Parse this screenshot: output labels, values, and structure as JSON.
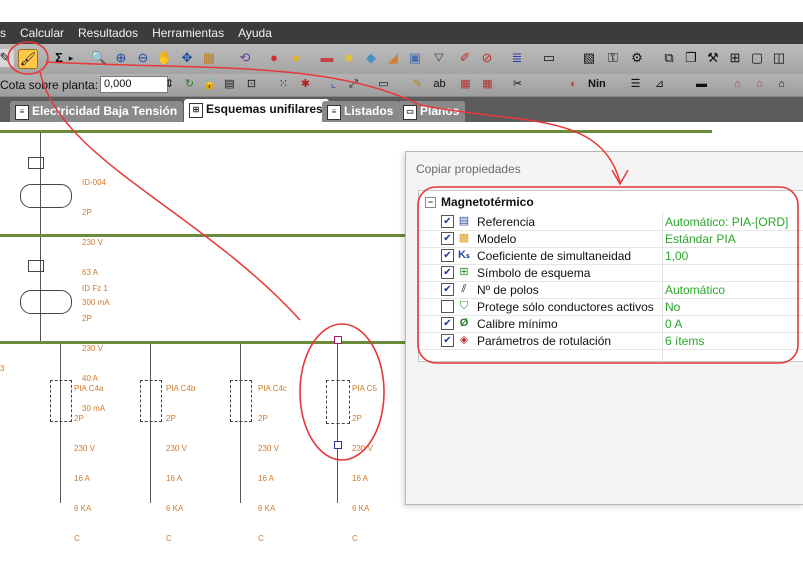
{
  "menu": [
    "s",
    "Calcular",
    "Resultados",
    "Herramientas",
    "Ayuda"
  ],
  "toolbar2": {
    "cota_label": "Cota sobre planta:",
    "cota_value": "0,000",
    "language_label": "Nin"
  },
  "tabs": [
    {
      "label": "Electricidad Baja Tensión",
      "active": false
    },
    {
      "label": "Esquemas unifilares",
      "active": true
    },
    {
      "label": "Listados",
      "active": false
    },
    {
      "label": "Planos",
      "active": false
    }
  ],
  "schematic": {
    "elements": [
      {
        "id": "diff-top",
        "lines": [
          "ID-004",
          "2P",
          "230 V",
          "63 A",
          "300 mA"
        ]
      },
      {
        "id": "diff-2",
        "lines": [
          "ID Fz 1",
          "2P",
          "230 V",
          "40 A",
          "30 mA"
        ]
      },
      {
        "id": "pia-c4a",
        "lines": [
          "PIA C4a",
          "2P",
          "230 V",
          "16 A",
          "6 KA",
          "C"
        ]
      },
      {
        "id": "pia-c4b",
        "lines": [
          "PIA C4b",
          "2P",
          "230 V",
          "16 A",
          "6 KA",
          "C"
        ]
      },
      {
        "id": "pia-c4c",
        "lines": [
          "PIA C4c",
          "2P",
          "230 V",
          "16 A",
          "6 KA",
          "C"
        ]
      },
      {
        "id": "pia-c5",
        "lines": [
          "PIA C5",
          "2P",
          "230 V",
          "16 A",
          "6 KA",
          "C"
        ]
      }
    ],
    "partial_label": "3"
  },
  "dialog": {
    "title": "Copiar propiedades",
    "group": "Magnetotérmico",
    "properties": [
      {
        "name": "Referencia",
        "value": "Automático: PIA-[ORD]",
        "checked": true,
        "icon": "reference-icon"
      },
      {
        "name": "Modelo",
        "value": "Estándar PIA",
        "checked": true,
        "icon": "model-box-icon"
      },
      {
        "name": "Coeficiente de simultaneidad",
        "value": "1,00",
        "checked": true,
        "icon": "ks-coefficient-icon"
      },
      {
        "name": "Símbolo de esquema",
        "value": "",
        "checked": true,
        "icon": "schema-symbol-icon"
      },
      {
        "name": "Nº de polos",
        "value": "Automático",
        "checked": true,
        "icon": "poles-icon"
      },
      {
        "name": "Protege sólo conductores activos",
        "value": "No",
        "checked": false,
        "icon": "shield-check-icon"
      },
      {
        "name": "Calibre mínimo",
        "value": "0 A",
        "checked": true,
        "icon": "calibre-icon"
      },
      {
        "name": "Parámetros de rotulación",
        "value": "6 ítems",
        "checked": true,
        "icon": "label-tag-icon"
      }
    ]
  },
  "colors": {
    "annotation_red": "#e83838",
    "value_green": "#2aa52a",
    "label_orange": "#d07a2a",
    "bus_green": "#6a8a3c"
  }
}
